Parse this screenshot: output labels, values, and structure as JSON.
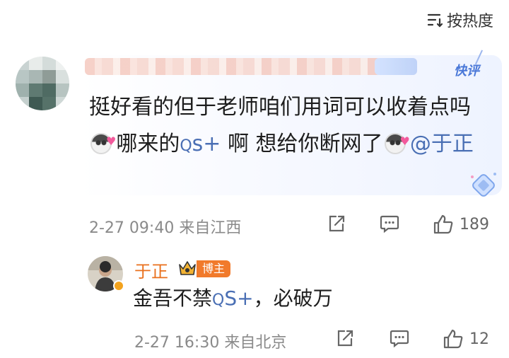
{
  "sort": {
    "label": "按热度",
    "icon": "sort-lines-icon"
  },
  "comment": {
    "quick_badge": "快评",
    "text_1": "挺好看的但于老师咱们用词可以收着点吗",
    "text_2": "哪来的",
    "topic_glyph": "Q",
    "topic": "s+",
    "text_3": " 啊  想给你断网了",
    "mention": "@于正",
    "meta": "2-27 09:40  来自江西",
    "like_count": "189"
  },
  "reply": {
    "name": "于正",
    "role_badge": "博主",
    "text_1": "金吾不禁",
    "topic_glyph": "Q",
    "topic": "S+",
    "text_2": "，必破万",
    "meta": "2-27 16:30  来自北京",
    "like_count": "12"
  },
  "colors": {
    "link": "#4a6fb4",
    "author": "#e9701d",
    "badge": "#f17a2b",
    "meta": "#8a8a8a"
  }
}
